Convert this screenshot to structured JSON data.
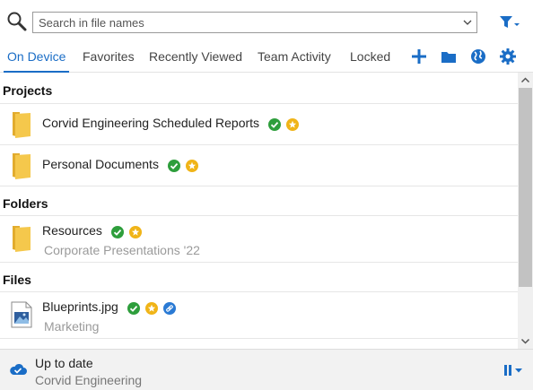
{
  "search": {
    "placeholder": "Search in file names",
    "value": ""
  },
  "tabs": [
    {
      "label": "On Device",
      "active": true
    },
    {
      "label": "Favorites",
      "active": false
    },
    {
      "label": "Recently Viewed",
      "active": false
    },
    {
      "label": "Team Activity",
      "active": false
    },
    {
      "label": "Locked",
      "active": false
    }
  ],
  "toolbar": [
    "add-icon",
    "folder-icon",
    "globe-icon",
    "gear-icon"
  ],
  "sections": {
    "projects": "Projects",
    "folders": "Folders",
    "files": "Files"
  },
  "projects": [
    {
      "name": "Corvid Engineering Scheduled Reports",
      "badges": [
        "synced",
        "favorite"
      ]
    },
    {
      "name": "Personal Documents",
      "badges": [
        "synced",
        "favorite"
      ]
    }
  ],
  "folders": [
    {
      "name": "Resources",
      "subtitle": "Corporate Presentations '22",
      "badges": [
        "synced",
        "favorite"
      ]
    }
  ],
  "files": [
    {
      "name": "Blueprints.jpg",
      "subtitle": "Marketing",
      "badges": [
        "synced",
        "favorite",
        "link"
      ]
    }
  ],
  "status": {
    "title": "Up to date",
    "subtitle": "Corvid Engineering"
  },
  "colors": {
    "accent": "#1a6dc6",
    "synced": "#2e9e3c",
    "favorite": "#f0b418",
    "folder": "#f5c84c"
  }
}
